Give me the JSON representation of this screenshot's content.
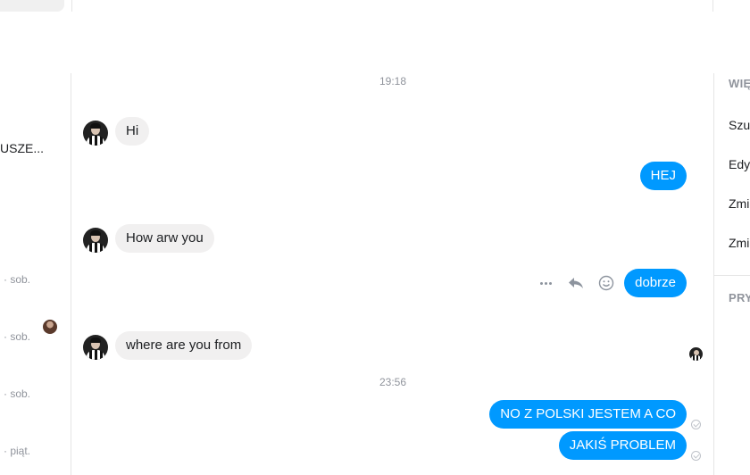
{
  "left_panel": {
    "conversation_name": "USZE...",
    "times": [
      "· sob.",
      "· sob.",
      "· sob.",
      "· piąt."
    ]
  },
  "chat": {
    "timestamps": [
      "19:18",
      "23:56"
    ],
    "messages": [
      {
        "direction": "in",
        "text": "Hi"
      },
      {
        "direction": "out",
        "text": "HEJ"
      },
      {
        "direction": "in",
        "text": "How arw you"
      },
      {
        "direction": "out",
        "text": "dobrze"
      },
      {
        "direction": "in",
        "text": "where are you from"
      },
      {
        "direction": "out",
        "text": "NO Z POLSKI JESTEM A CO"
      },
      {
        "direction": "out",
        "text": "JAKIŚ PROBLEM"
      }
    ],
    "message_actions": [
      "more-icon",
      "reply-icon",
      "emoji-icon"
    ]
  },
  "right_panel": {
    "heading_more": "WIĘ",
    "items": [
      "Szuk",
      "Edyt",
      "Zmie",
      "Zmie"
    ],
    "heading_privacy": "PRY"
  },
  "colors": {
    "outgoing_bubble": "#0099ff",
    "incoming_bubble": "#f1f0f0",
    "meta_text": "#90949c"
  }
}
